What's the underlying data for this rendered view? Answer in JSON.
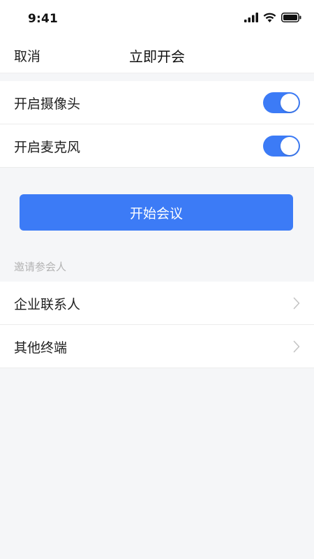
{
  "status_bar": {
    "time": "9:41",
    "icons": [
      "signal-icon",
      "wifi-icon",
      "battery-icon"
    ]
  },
  "nav": {
    "cancel_label": "取消",
    "title": "立即开会"
  },
  "settings": {
    "camera_label": "开启摄像头",
    "camera_on": true,
    "microphone_label": "开启麦克风",
    "microphone_on": true
  },
  "start_button_label": "开始会议",
  "invite": {
    "section_title": "邀请参会人",
    "items": [
      {
        "label": "企业联系人",
        "icon": "chevron-right-icon"
      },
      {
        "label": "其他终端",
        "icon": "chevron-right-icon"
      }
    ]
  },
  "colors": {
    "accent": "#3c7bf6",
    "background": "#f5f6f8",
    "surface": "#ffffff",
    "muted_text": "#b3b3b3"
  }
}
